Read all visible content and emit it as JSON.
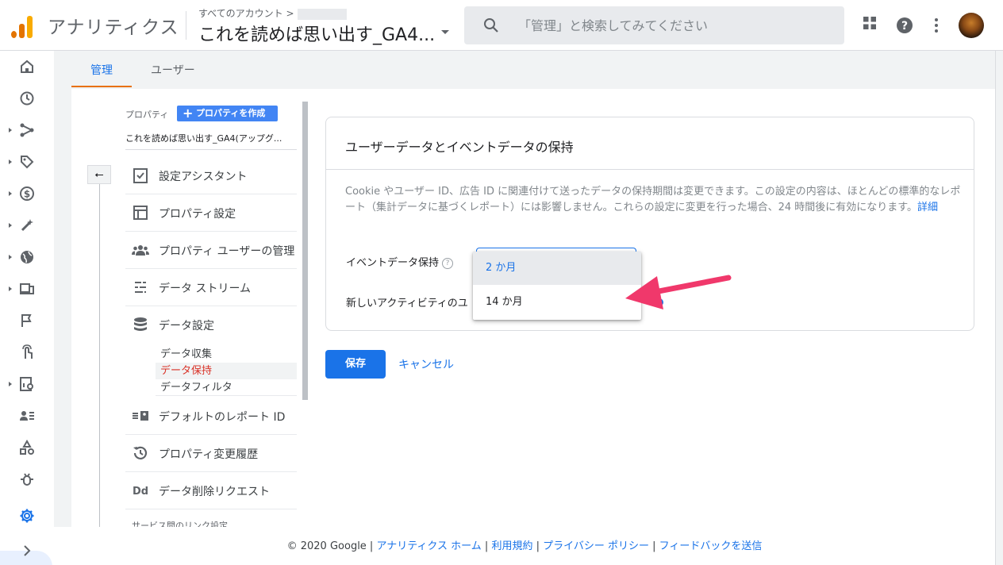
{
  "header": {
    "app_name": "アナリティクス",
    "breadcrumb": "すべてのアカウント >",
    "property_title": "これを読めば思い出す_GA4...",
    "search_placeholder": "「管理」と検索してみてください"
  },
  "tabs": [
    "管理",
    "ユーザー"
  ],
  "property_column": {
    "label": "プロパティ",
    "create_button": "プロパティを作成",
    "property_name": "これを読めば思い出す_GA4(アップグ...",
    "menu": [
      "設定アシスタント",
      "プロパティ設定",
      "プロパティ ユーザーの管理",
      "データ ストリーム",
      "データ設定"
    ],
    "sub_items": [
      "データ収集",
      "データ保持",
      "データフィルタ"
    ],
    "menu_after": [
      "デフォルトのレポート ID",
      "プロパティ変更履歴",
      "データ削除リクエスト"
    ],
    "cut_item": "サービス間のリンク設定"
  },
  "card": {
    "title": "ユーザーデータとイベントデータの保持",
    "description": "Cookie やユーザー ID、広告 ID に関連付けて送ったデータの保持期間は変更できます。この設定の内容は、ほとんどの標準的なレポート（集計データに基づくレポート）には影響しません。これらの設定に変更を行った場合、24 時間後に有効になります。",
    "description_link": "詳細",
    "event_retention_label": "イベントデータ保持",
    "reset_label": "新しいアクティビティのユ",
    "options": [
      "2 か月",
      "14 か月"
    ],
    "selected_option": "2 か月"
  },
  "actions": {
    "save": "保存",
    "cancel": "キャンセル"
  },
  "footer": {
    "copyright": "© 2020 Google |",
    "links": [
      "アナリティクス ホーム",
      "利用規約",
      "プライバシー ポリシー",
      "フィードバックを送信"
    ]
  },
  "colors": {
    "accent": "#1a73e8",
    "active_sub": "#d93025",
    "tab_underline": "#e8710a",
    "arrow": "#f0386b"
  }
}
